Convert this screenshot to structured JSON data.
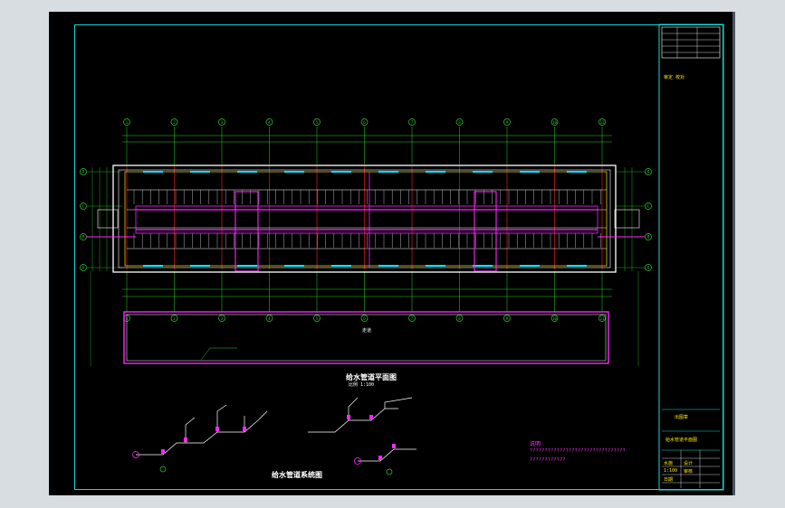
{
  "drawing": {
    "plan_title": "给水管道平面图",
    "plan_scale_note": "比例 1:100",
    "system_title": "给水管道系统图",
    "corridor_label": "走道",
    "notes_heading": "说明",
    "notes_lines": [
      "????????????????????????????????",
      "????????????"
    ],
    "grid_columns": [
      "1",
      "2",
      "3",
      "4",
      "5",
      "6",
      "7",
      "8",
      "9",
      "10",
      "11"
    ],
    "grid_rows": [
      "A",
      "B",
      "C",
      "D"
    ]
  },
  "title_block": {
    "stamp_label": "审定 校对",
    "project_label": "出图章",
    "sheet_name": "给水管道平面图",
    "drawing_no": "水施",
    "scale_value": "1:100",
    "date_value": "日期",
    "designer": "设计",
    "checker": "审核"
  },
  "colors": {
    "frame": "#18d6d6",
    "grid": "#2cd12c",
    "wall": "#ffffff",
    "pipe": "#ff26ff",
    "fixture": "#00e5ff",
    "accent": "#ffea00",
    "red": "#ff2020"
  }
}
